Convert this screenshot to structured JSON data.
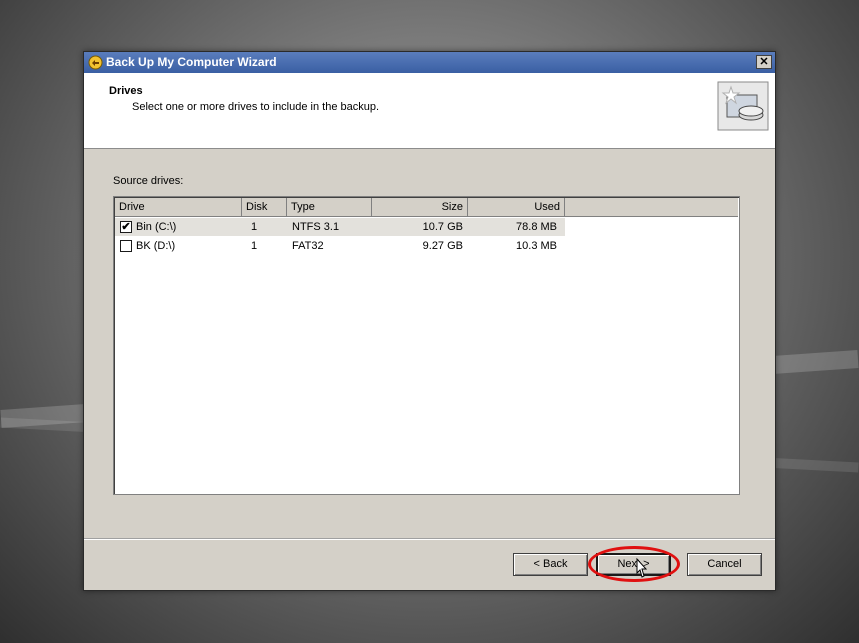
{
  "window": {
    "title": "Back Up My Computer Wizard"
  },
  "header": {
    "title": "Drives",
    "subtitle": "Select one or more drives to include in the backup."
  },
  "list": {
    "label": "Source drives:",
    "columns": [
      "Drive",
      "Disk",
      "Type",
      "Size",
      "Used"
    ],
    "rows": [
      {
        "checked": true,
        "drive": "Bin (C:\\)",
        "disk": "1",
        "type": "NTFS 3.1",
        "size": "10.7 GB",
        "used": "78.8 MB"
      },
      {
        "checked": false,
        "drive": "BK (D:\\)",
        "disk": "1",
        "type": "FAT32",
        "size": "9.27 GB",
        "used": "10.3 MB"
      }
    ]
  },
  "buttons": {
    "back": "< Back",
    "next": "Next >",
    "cancel": "Cancel"
  },
  "colors": {
    "titlebar": "#3a5fa3",
    "annotation": "#e01010",
    "dialog_bg": "#d4d0c8"
  },
  "icons": {
    "app": "backup-wizard-icon",
    "header": "drives-backup-icon",
    "close": "close-icon"
  }
}
